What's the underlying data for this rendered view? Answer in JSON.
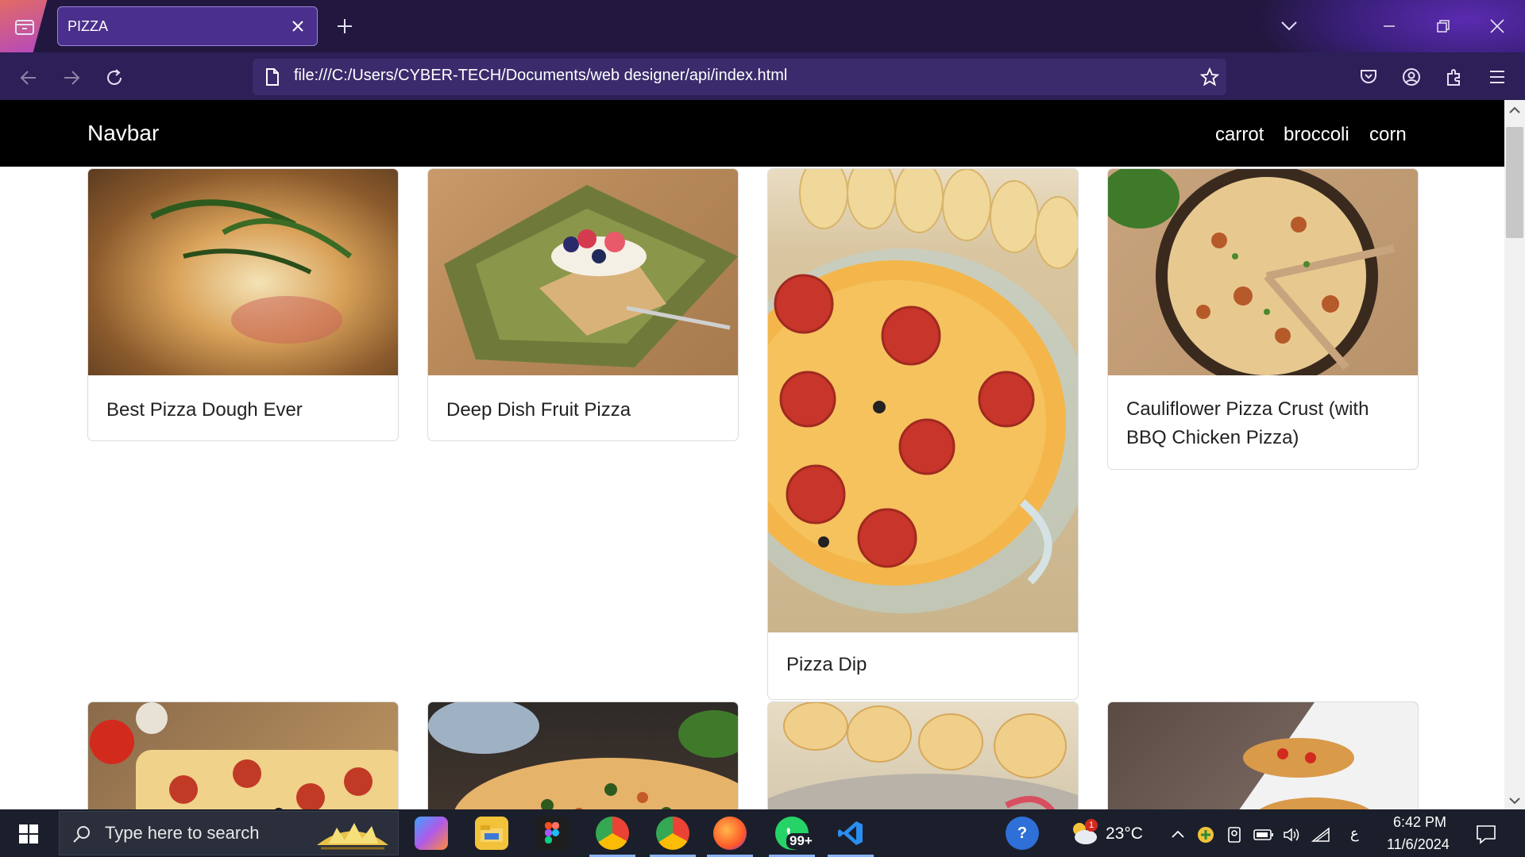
{
  "browser": {
    "tab_title": "PIZZA",
    "url": "file:///C:/Users/CYBER-TECH/Documents/web designer/api/index.html"
  },
  "site": {
    "brand": "Navbar",
    "nav_links": [
      "carrot",
      "broccoli",
      "corn"
    ]
  },
  "cards": [
    {
      "title": "Best Pizza Dough Ever",
      "image": "pizza-dough-photo"
    },
    {
      "title": "Deep Dish Fruit Pizza",
      "image": "fruit-pizza-photo"
    },
    {
      "title": "Pizza Dip",
      "image": "pizza-dip-photo"
    },
    {
      "title_line1": "Cauliflower Pizza Crust (with",
      "title_line2": "BBQ Chicken Pizza)",
      "image": "cauliflower-pizza-photo"
    }
  ],
  "taskbar": {
    "search_placeholder": "Type here to search",
    "weather": "23°C",
    "time": "6:42 PM",
    "date": "11/6/2024",
    "whatsapp_badge": "99+",
    "weather_badge": "1",
    "lang_indicator": "ع"
  },
  "colors": {
    "chrome_bg": "#22183f",
    "toolbar_bg": "#2d1f57",
    "site_nav_bg": "#000000",
    "taskbar_bg": "#1b1f2b"
  }
}
